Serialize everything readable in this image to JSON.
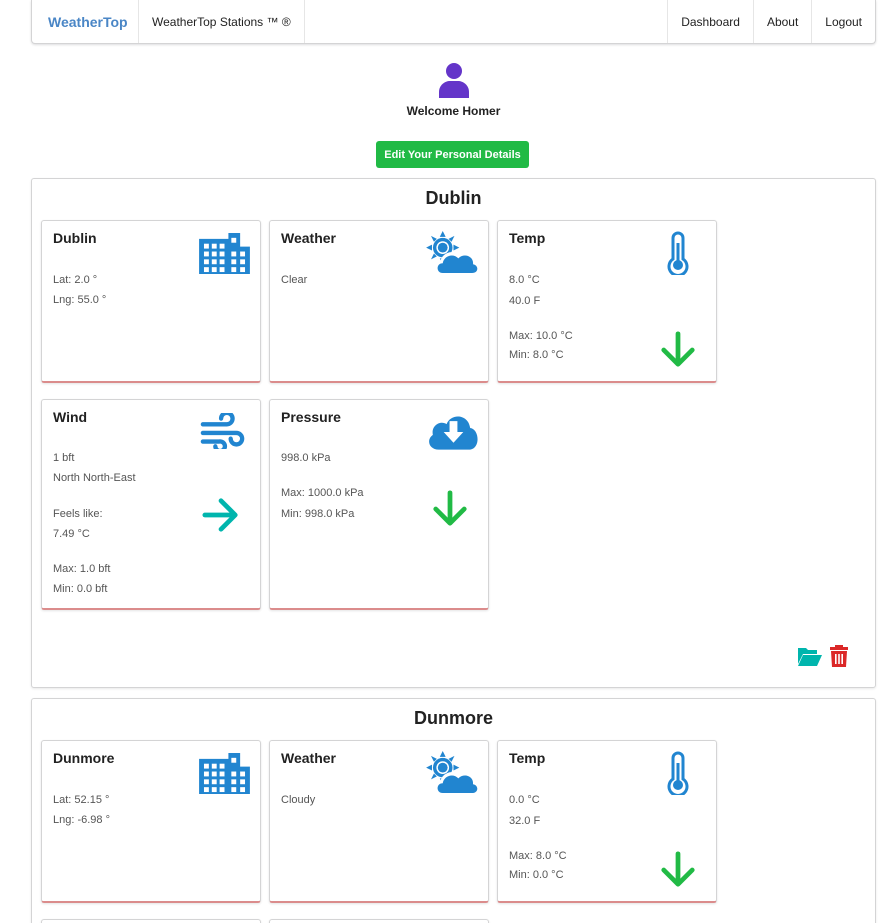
{
  "nav": {
    "brand": "WeatherTop",
    "stations": "WeatherTop Stations ™ ®",
    "dashboard": "Dashboard",
    "about": "About",
    "logout": "Logout"
  },
  "welcome": "Welcome Homer",
  "edit_button": "Edit Your Personal Details",
  "colors": {
    "icon_blue": "#2185d0",
    "trend_green": "#21ba45",
    "arrow_teal": "#00b5ad",
    "delete_red": "#db2828",
    "user_purple": "#6435c9"
  },
  "stations": [
    {
      "name": "Dublin",
      "location": {
        "title": "Dublin",
        "lat": "Lat: 2.0 °",
        "lng": "Lng: 55.0 °",
        "icon": "building-icon"
      },
      "weather": {
        "title": "Weather",
        "condition": "Clear",
        "icon": "sun-cloud-icon"
      },
      "temp": {
        "title": "Temp",
        "c": "8.0 °C",
        "f": "40.0 F",
        "max": "Max: 10.0 °C",
        "min": "Min: 8.0 °C",
        "icon": "thermometer-icon",
        "trend": "down"
      },
      "wind": {
        "title": "Wind",
        "speed": "1 bft",
        "direction": "North North-East",
        "feels_label": "Feels like:",
        "feels": "7.49 °C",
        "max": "Max: 1.0 bft",
        "min": "Min: 0.0 bft",
        "icon": "wind-icon",
        "arrow": "right"
      },
      "pressure": {
        "title": "Pressure",
        "value": "998.0 kPa",
        "max": "Max: 1000.0 kPa",
        "min": "Min: 998.0 kPa",
        "icon": "cloud-download-icon",
        "trend": "down"
      }
    },
    {
      "name": "Dunmore",
      "location": {
        "title": "Dunmore",
        "lat": "Lat: 52.15 °",
        "lng": "Lng: -6.98 °",
        "icon": "building-icon"
      },
      "weather": {
        "title": "Weather",
        "condition": "Cloudy",
        "icon": "sun-cloud-icon"
      },
      "temp": {
        "title": "Temp",
        "c": "0.0 °C",
        "f": "32.0 F",
        "max": "Max: 8.0 °C",
        "min": "Min: 0.0 °C",
        "icon": "thermometer-icon",
        "trend": "down"
      }
    }
  ]
}
